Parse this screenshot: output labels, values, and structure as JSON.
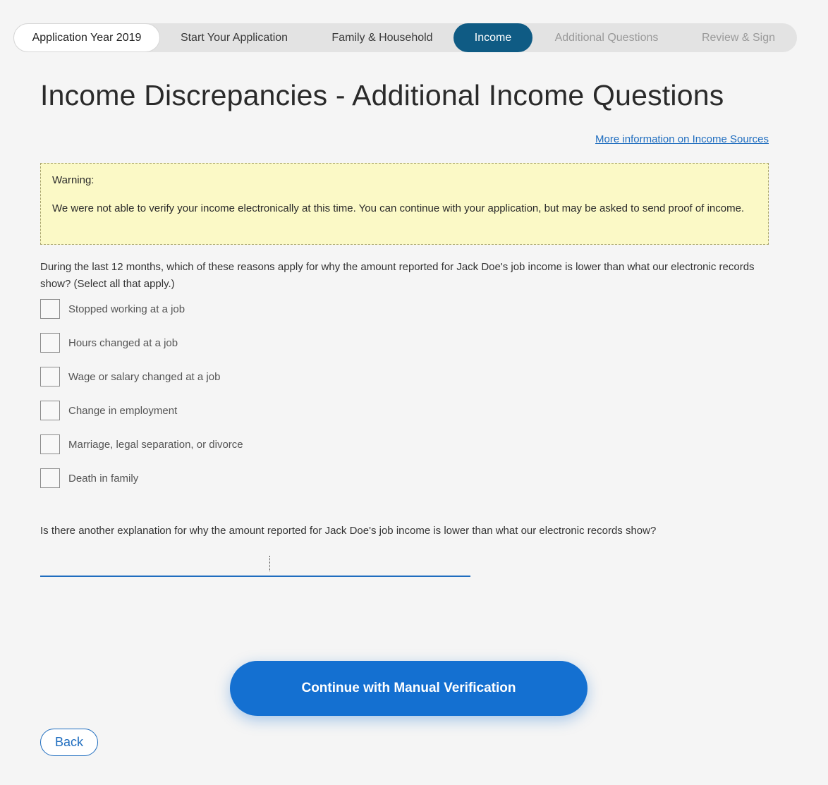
{
  "nav": {
    "year": "Application Year 2019",
    "steps": [
      {
        "label": "Start Your Application",
        "state": "normal"
      },
      {
        "label": "Family & Household",
        "state": "normal"
      },
      {
        "label": "Income",
        "state": "active"
      },
      {
        "label": "Additional Questions",
        "state": "disabled"
      },
      {
        "label": "Review & Sign",
        "state": "disabled"
      }
    ]
  },
  "page": {
    "title": "Income Discrepancies - Additional Income Questions",
    "info_link": "More information on Income Sources"
  },
  "warning": {
    "title": "Warning:",
    "body": "We were not able to verify your income electronically at this time. You can continue with your application, but may be asked to send proof of income."
  },
  "question1": {
    "text": "During the last 12 months, which of these reasons apply for why the amount reported for Jack Doe's job income is lower than what our electronic records show? (Select all that apply.)",
    "options": [
      {
        "label": "Stopped working at a job",
        "checked": false
      },
      {
        "label": "Hours changed at a job",
        "checked": false
      },
      {
        "label": "Wage or salary changed at a job",
        "checked": false
      },
      {
        "label": "Change in employment",
        "checked": false
      },
      {
        "label": "Marriage, legal separation, or divorce",
        "checked": false
      },
      {
        "label": "Death in family",
        "checked": false
      }
    ]
  },
  "question2": {
    "text": "Is there another explanation for why the amount reported for Jack Doe's job income is lower than what our electronic records show?",
    "value": "",
    "placeholder": ""
  },
  "actions": {
    "continue_label": "Continue with Manual Verification",
    "back_label": "Back"
  },
  "colors": {
    "active_step": "#0f5b84",
    "primary": "#1470d1",
    "link": "#1f6dbf",
    "warning_bg": "#fbf9c6"
  }
}
